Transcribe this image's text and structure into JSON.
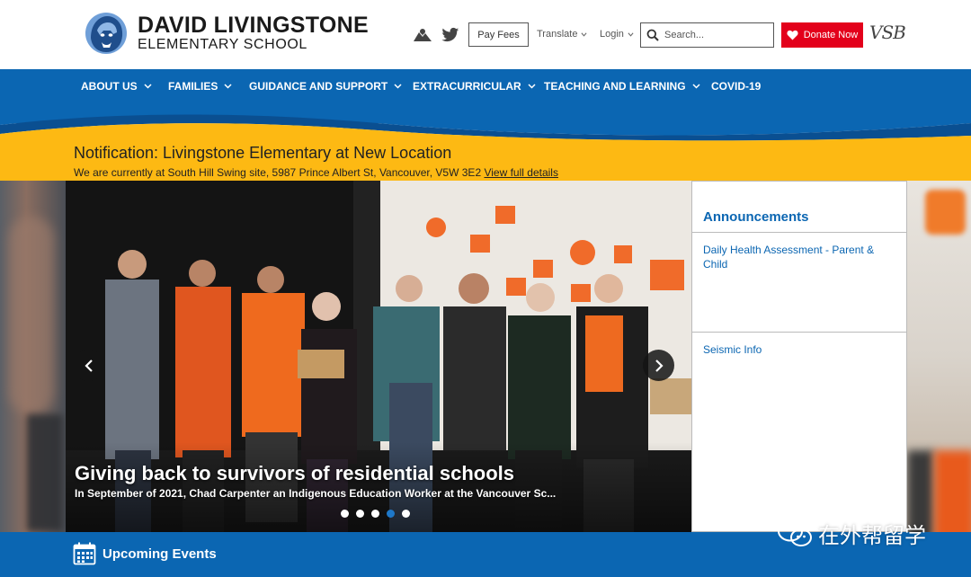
{
  "header": {
    "school_name_line1": "DAVID LIVINGSTONE",
    "school_name_line2": "ELEMENTARY SCHOOL",
    "pay_fees_label": "Pay Fees",
    "translate_label": "Translate",
    "login_label": "Login",
    "search_placeholder": "Search...",
    "donate_label": "Donate Now",
    "vsb_logo_text": "VSB",
    "icons": [
      "map-icon",
      "twitter-icon",
      "chevron-down-icon",
      "search-icon",
      "heart-icon"
    ]
  },
  "nav": {
    "items": [
      {
        "label": "ABOUT US",
        "has_dropdown": true
      },
      {
        "label": "FAMILIES",
        "has_dropdown": true
      },
      {
        "label": "GUIDANCE AND SUPPORT",
        "has_dropdown": true
      },
      {
        "label": "EXTRACURRICULAR",
        "has_dropdown": true
      },
      {
        "label": "TEACHING AND LEARNING",
        "has_dropdown": true
      },
      {
        "label": "COVID-19",
        "has_dropdown": false
      }
    ]
  },
  "notification": {
    "title": "Notification: Livingstone Elementary at New Location",
    "text": "We are currently at South Hill Swing site, 5987 Prince Albert St, Vancouver, V5W 3E2",
    "link_label": "View full details"
  },
  "slider": {
    "title": "Giving back to survivors of residential schools",
    "text": "In September of 2021, Chad Carpenter an Indigenous Education Worker at the Vancouver Sc...",
    "total_slides": 5,
    "active_slide": 4
  },
  "announcements": {
    "title": "Announcements",
    "items": [
      {
        "label": "Daily Health Assessment - Parent & Child"
      },
      {
        "label": "Seismic Info"
      }
    ]
  },
  "events": {
    "label": "Upcoming Events"
  },
  "watermark": {
    "text": "在外帮留学"
  },
  "colors": {
    "brand_blue": "#0b66b2",
    "notification_yellow": "#fdb913",
    "donate_red": "#e3001b",
    "active_dot": "#1e78c8"
  }
}
